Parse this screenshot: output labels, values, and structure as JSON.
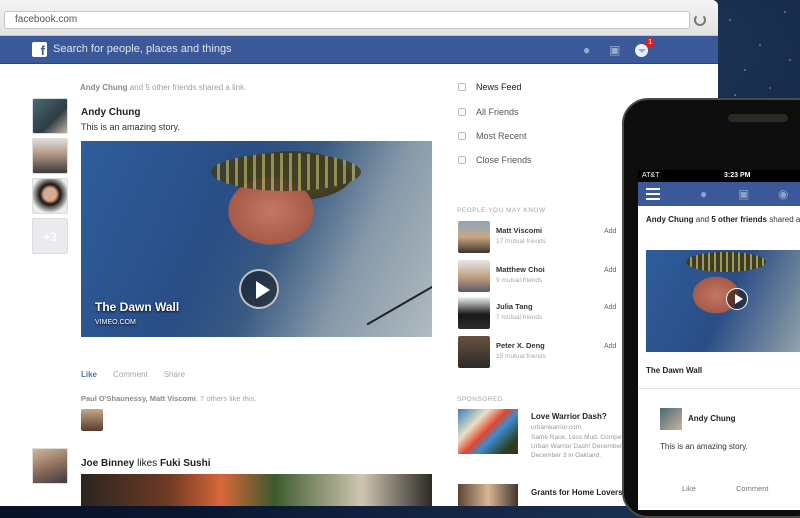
{
  "browser": {
    "url": "facebook.com"
  },
  "fb_header": {
    "search_placeholder": "Search for people, places and things",
    "notification_count": "1"
  },
  "feed": {
    "story1": {
      "meta_actor": "Andy Chung",
      "meta_rest": "and 5 other friends shared a link.",
      "poster": "Andy Chung",
      "text": "This is an amazing story.",
      "more_avatars": "+3",
      "video_title": "The Dawn Wall",
      "video_source": "VIMEO.COM",
      "like": "Like",
      "comment": "Comment",
      "share": "Share",
      "likes_names": "Paul O'Shaunessy, Matt Viscomi",
      "likes_rest": ", 7 others like this."
    },
    "story2": {
      "actor": "Joe Binney",
      "verb": "likes",
      "page": "Fuki Sushi"
    }
  },
  "sidebar": {
    "nav": [
      "News Feed",
      "All Friends",
      "Most Recent",
      "Close Friends"
    ],
    "pymk_title": "PEOPLE YOU MAY KNOW",
    "people": [
      {
        "name": "Matt Viscomi",
        "mutual": "17 mutual friends",
        "action": "Add"
      },
      {
        "name": "Matthew Choi",
        "mutual": "9 mutual friends",
        "action": "Add"
      },
      {
        "name": "Julia Tang",
        "mutual": "7 mutual friends",
        "action": "Add"
      },
      {
        "name": "Peter X. Deng",
        "mutual": "15 mutual friends",
        "action": "Add"
      }
    ],
    "sponsored_title": "SPONSORED",
    "ads": [
      {
        "title": "Love Warrior Dash?",
        "url": "urbanwarrior.com",
        "text": "Same Race, Less Mud. Compete in Urban Warrior Dash! December 2 and December 3 in Oakland."
      },
      {
        "title": "Grants for Home Lovers?",
        "url": "",
        "text": ""
      }
    ]
  },
  "phone": {
    "carrier": "AT&T",
    "time": "3:23 PM",
    "story_actor": "Andy Chung",
    "story_mid": "and",
    "story_friends": "5 other friends",
    "story_end": "shared a link.",
    "video_title": "The Dawn Wall",
    "poster": "Andy Chung",
    "text": "This is an amazing story.",
    "like": "Like",
    "comment": "Comment"
  }
}
